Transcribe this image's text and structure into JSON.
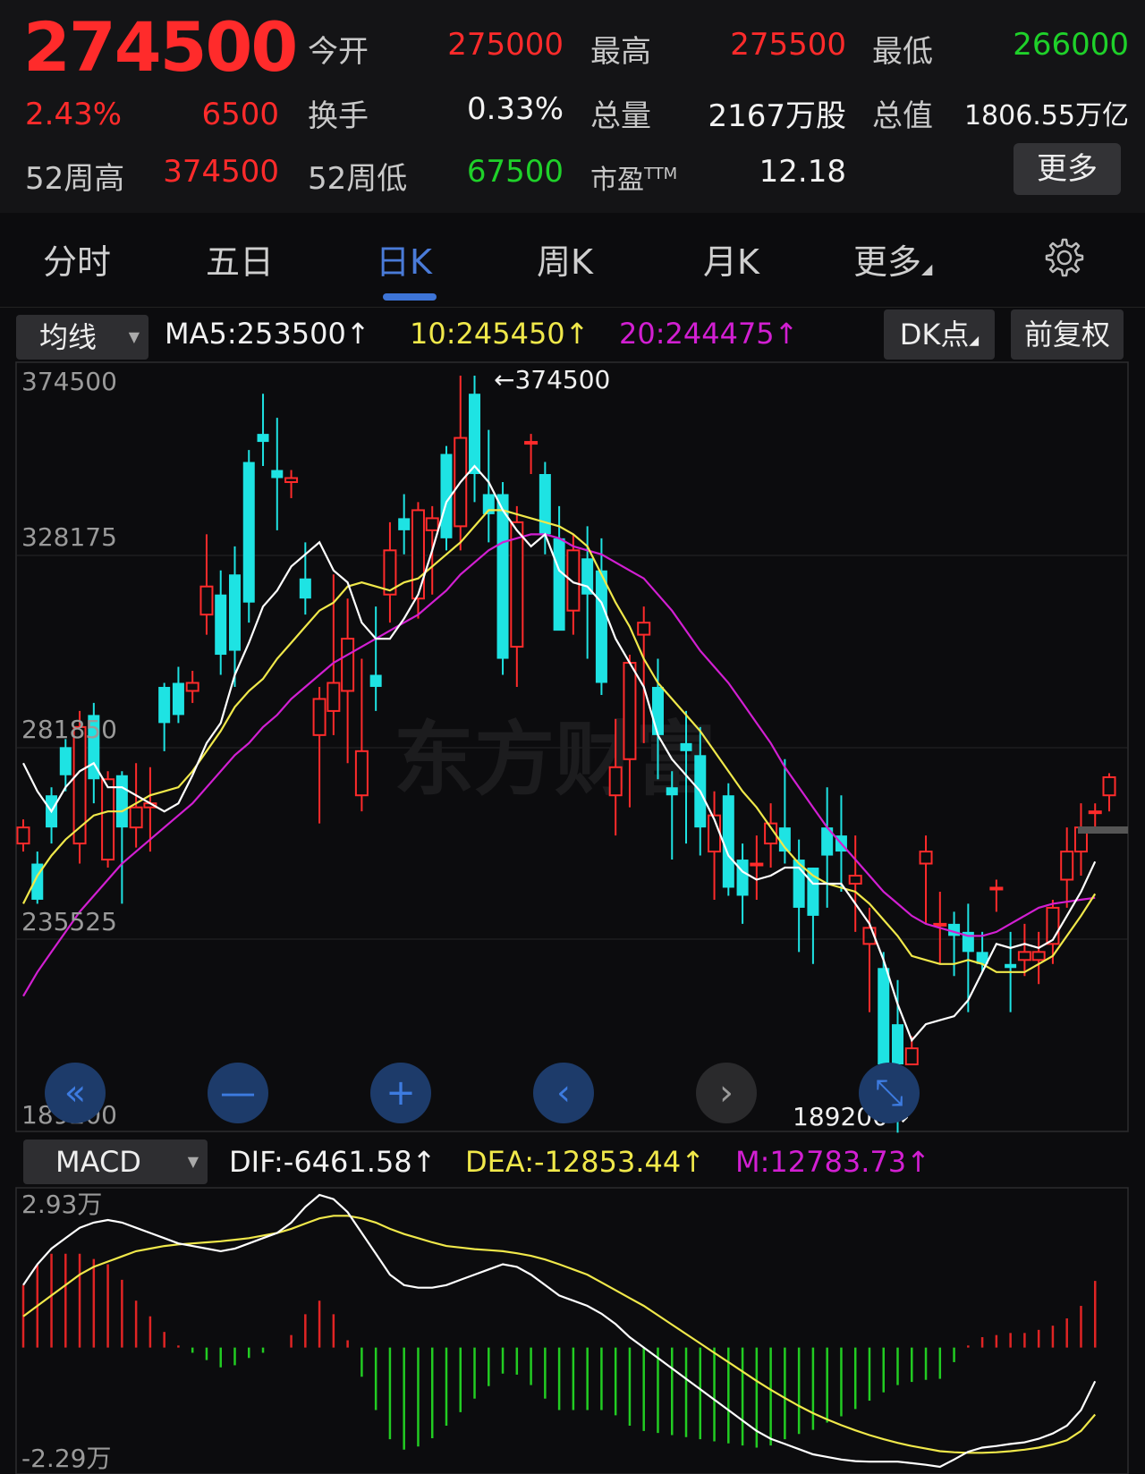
{
  "quote": {
    "price": "274500",
    "change_pct": "2.43%",
    "change_amt": "6500",
    "open_label": "今开",
    "open": "275000",
    "high_label": "最高",
    "high": "275500",
    "low_label": "最低",
    "low": "266000",
    "turnover_label": "换手",
    "turnover": "0.33%",
    "volume_label": "总量",
    "volume": "2167万股",
    "mktcap_label": "总值",
    "mktcap": "1806.55万亿",
    "w52h_label": "52周高",
    "w52h": "374500",
    "w52l_label": "52周低",
    "w52l": "67500",
    "pe_label": "市盈",
    "pe_sup": "TTM",
    "pe": "12.18",
    "more_label": "更多"
  },
  "tabs": [
    {
      "label": "分时",
      "active": false
    },
    {
      "label": "五日",
      "active": false
    },
    {
      "label": "日K",
      "active": true
    },
    {
      "label": "周K",
      "active": false
    },
    {
      "label": "月K",
      "active": false
    },
    {
      "label": "更多",
      "active": false
    }
  ],
  "settings_icon": "gear-icon",
  "ma_bar": {
    "selector": "均线",
    "ma5": "MA5:253500↑",
    "ma10": "10:245450↑",
    "ma20": "20:244475↑",
    "dk_label": "DK点",
    "adjust_label": "前复权"
  },
  "kline": {
    "y_labels": [
      "374500",
      "328175",
      "281850",
      "235525",
      "189200"
    ],
    "max_note": "←374500",
    "min_note": "189200→",
    "watermark": "东方财富"
  },
  "controls": [
    {
      "icon": "double-left-icon",
      "glyph": "«"
    },
    {
      "icon": "zoom-out-icon",
      "glyph": "—"
    },
    {
      "icon": "zoom-in-icon",
      "glyph": "+"
    },
    {
      "icon": "left-icon",
      "glyph": "‹"
    },
    {
      "icon": "right-icon",
      "glyph": "›"
    },
    {
      "icon": "fullscreen-icon",
      "glyph": "⤡"
    }
  ],
  "macd_bar": {
    "selector": "MACD",
    "dif": "DIF:-6461.58↑",
    "dea": "DEA:-12853.44↑",
    "m": "M:12783.73↑",
    "y_top": "2.93万",
    "y_bottom": "-2.29万"
  },
  "colors": {
    "up": "#ff2b2b",
    "down": "#1ee3e3",
    "ma5": "#ffffff",
    "ma10": "#f0e84a",
    "ma20": "#d21fd2",
    "macd_up": "#e02424",
    "macd_down": "#22cc22"
  },
  "chart_data": {
    "type": "candlestick",
    "ylim": [
      189200,
      374500
    ],
    "candles": [
      [
        258000,
        262000,
        264000,
        256000
      ],
      [
        253000,
        244000,
        256000,
        243000
      ],
      [
        270000,
        262000,
        272000,
        258000
      ],
      [
        282000,
        275000,
        284000,
        271000
      ],
      [
        258000,
        287000,
        291000,
        253000
      ],
      [
        290000,
        274000,
        293000,
        268000
      ],
      [
        254000,
        274000,
        276000,
        252000
      ],
      [
        275000,
        262000,
        276000,
        243000
      ],
      [
        262000,
        267000,
        278000,
        257000
      ],
      [
        267000,
        268000,
        277000,
        256000
      ],
      [
        297000,
        288000,
        298000,
        281000
      ],
      [
        298000,
        290000,
        302000,
        288000
      ],
      [
        296000,
        298000,
        301000,
        293000
      ],
      [
        315000,
        322000,
        335000,
        310000
      ],
      [
        320000,
        305000,
        326000,
        300000
      ],
      [
        325000,
        306000,
        332000,
        297000
      ],
      [
        353000,
        318000,
        356000,
        313000
      ],
      [
        360000,
        358000,
        370000,
        352000
      ],
      [
        351000,
        349000,
        364000,
        336000
      ],
      [
        348000,
        349000,
        351000,
        344000
      ],
      [
        324000,
        319000,
        333000,
        315000
      ],
      [
        285000,
        294000,
        297000,
        263000
      ],
      [
        291000,
        298000,
        325000,
        285000
      ],
      [
        296000,
        309000,
        319000,
        278000
      ],
      [
        270000,
        281000,
        304000,
        266000
      ],
      [
        300000,
        297000,
        317000,
        291000
      ],
      [
        320000,
        331000,
        338000,
        313000
      ],
      [
        339000,
        336000,
        345000,
        330000
      ],
      [
        319000,
        341000,
        343000,
        314000
      ],
      [
        336000,
        339000,
        342000,
        320000
      ],
      [
        355000,
        334000,
        357000,
        331000
      ],
      [
        337000,
        359000,
        374500,
        331000
      ],
      [
        370000,
        350000,
        374500,
        343000
      ],
      [
        345000,
        340000,
        361000,
        333000
      ],
      [
        345000,
        304000,
        348000,
        300000
      ],
      [
        307000,
        338000,
        342000,
        297000
      ],
      [
        358000,
        358000,
        360000,
        350000
      ],
      [
        350000,
        335000,
        353000,
        330000
      ],
      [
        334000,
        311000,
        342000,
        314000
      ],
      [
        316000,
        331000,
        335000,
        310000
      ],
      [
        329000,
        320000,
        337000,
        304000
      ],
      [
        326000,
        298000,
        334000,
        295000
      ],
      [
        270000,
        277000,
        289000,
        260000
      ],
      [
        279000,
        303000,
        305000,
        267000
      ],
      [
        310000,
        313000,
        317000,
        283000
      ],
      [
        297000,
        285000,
        304000,
        274000
      ],
      [
        272000,
        270000,
        276000,
        254000
      ],
      [
        283000,
        281000,
        291000,
        258000
      ],
      [
        280000,
        262000,
        287000,
        255000
      ],
      [
        256000,
        265000,
        271000,
        244000
      ],
      [
        270000,
        247000,
        273000,
        245000
      ],
      [
        254000,
        245000,
        258000,
        238000
      ],
      [
        253000,
        253000,
        260000,
        244000
      ],
      [
        258000,
        263000,
        268000,
        252000
      ],
      [
        262000,
        256000,
        279000,
        253000
      ],
      [
        254000,
        242000,
        259000,
        231000
      ],
      [
        252000,
        240000,
        252000,
        228000
      ],
      [
        262000,
        255000,
        272000,
        242000
      ],
      [
        260000,
        256000,
        270000,
        246000
      ],
      [
        248000,
        250000,
        260000,
        236000
      ],
      [
        233000,
        237000,
        242000,
        216000
      ],
      [
        227000,
        203000,
        231000,
        198000
      ],
      [
        213000,
        203000,
        224000,
        186000
      ],
      [
        203000,
        207000,
        210000,
        205000
      ],
      [
        253000,
        256000,
        260000,
        238000
      ],
      [
        238000,
        238000,
        246000,
        228000
      ],
      [
        238000,
        235000,
        241000,
        225000
      ],
      [
        236000,
        231000,
        243000,
        216000
      ],
      [
        231000,
        228000,
        236000,
        226000
      ],
      [
        247000,
        247000,
        249000,
        241000
      ],
      [
        228000,
        227000,
        236000,
        216000
      ],
      [
        229000,
        231000,
        238000,
        225000
      ],
      [
        229000,
        231000,
        236000,
        223000
      ],
      [
        233000,
        242000,
        244000,
        228000
      ],
      [
        249000,
        256000,
        262000,
        242000
      ],
      [
        256000,
        262000,
        268000,
        250000
      ],
      [
        266000,
        266000,
        268000,
        262000
      ],
      [
        270000,
        274500,
        275500,
        266000
      ]
    ],
    "ma5": [
      278000,
      271000,
      266000,
      272000,
      276000,
      278000,
      272000,
      272000,
      270000,
      268000,
      266000,
      268000,
      275000,
      283000,
      288000,
      300000,
      308000,
      317000,
      321000,
      327000,
      330000,
      333000,
      326000,
      323000,
      313000,
      309000,
      309000,
      314000,
      320000,
      331000,
      343000,
      348000,
      352000,
      348000,
      341000,
      336000,
      332000,
      335000,
      326000,
      323000,
      322000,
      318000,
      309000,
      303000,
      297000,
      285000,
      279000,
      275000,
      271000,
      264000,
      255000,
      251000,
      249000,
      250000,
      252000,
      252000,
      248000,
      248000,
      248000,
      243000,
      238000,
      229000,
      218000,
      209000,
      213000,
      214000,
      215000,
      219000,
      226000,
      233000,
      232000,
      233000,
      232000,
      234000,
      240000,
      246000,
      253500
    ],
    "ma10": [
      243000,
      250000,
      255000,
      259000,
      262000,
      265000,
      266000,
      266000,
      268000,
      270000,
      271000,
      272000,
      276000,
      281000,
      286000,
      292000,
      296000,
      299000,
      304000,
      308000,
      312000,
      316000,
      318000,
      322000,
      323000,
      322000,
      321000,
      323000,
      324000,
      327000,
      330000,
      333000,
      337000,
      341000,
      341000,
      340000,
      339000,
      338000,
      337000,
      335000,
      332000,
      325000,
      318000,
      312000,
      304000,
      298000,
      294000,
      290000,
      286000,
      281000,
      276000,
      271000,
      267000,
      262000,
      257000,
      253000,
      250000,
      248000,
      247000,
      246000,
      243000,
      239000,
      235000,
      230000,
      229000,
      228000,
      228000,
      229000,
      228000,
      226000,
      226000,
      226000,
      228000,
      230000,
      235000,
      240000,
      245450
    ],
    "ma20": [
      220000,
      226000,
      231000,
      236000,
      241000,
      245000,
      249000,
      253000,
      256000,
      259000,
      262000,
      265000,
      268000,
      272000,
      276000,
      280000,
      283000,
      287000,
      290000,
      294000,
      297000,
      300000,
      303000,
      305000,
      307000,
      309000,
      311000,
      313000,
      315000,
      318000,
      321000,
      325000,
      328000,
      331000,
      333000,
      334000,
      335000,
      335000,
      334000,
      332000,
      331000,
      330000,
      328000,
      326000,
      324000,
      320000,
      316000,
      311000,
      306000,
      302000,
      298000,
      293000,
      288000,
      283000,
      277000,
      272000,
      267000,
      262000,
      258000,
      254000,
      250000,
      246000,
      243000,
      240000,
      238000,
      237000,
      236000,
      235000,
      235000,
      236000,
      238000,
      240000,
      242000,
      243000,
      243500,
      244000,
      244475
    ],
    "macd_dif": [
      12000,
      16000,
      19000,
      21000,
      23000,
      24000,
      24500,
      24000,
      23000,
      22000,
      21000,
      20000,
      19500,
      19000,
      18500,
      19000,
      20000,
      21000,
      22000,
      24000,
      27000,
      29300,
      28500,
      26000,
      22000,
      18000,
      14000,
      12000,
      11500,
      11500,
      12000,
      13000,
      14000,
      15000,
      16000,
      15500,
      14000,
      12000,
      10000,
      9000,
      8000,
      6500,
      4500,
      2000,
      0,
      -2000,
      -4000,
      -6000,
      -8000,
      -10000,
      -12000,
      -14000,
      -16000,
      -17500,
      -18500,
      -19500,
      -20500,
      -21000,
      -21500,
      -21800,
      -21900,
      -21900,
      -21900,
      -22200,
      -22500,
      -22900,
      -21500,
      -20000,
      -19200,
      -18900,
      -18500,
      -18200,
      -17500,
      -16500,
      -15000,
      -12000,
      -6461.58
    ],
    "macd_dea": [
      6000,
      8000,
      10000,
      12000,
      14000,
      15500,
      16500,
      17500,
      18500,
      19000,
      19500,
      19800,
      20000,
      20200,
      20400,
      20700,
      21000,
      21500,
      22000,
      22800,
      23800,
      24800,
      25300,
      25300,
      24800,
      24000,
      22800,
      21800,
      21000,
      20200,
      19500,
      19200,
      18900,
      18700,
      18500,
      18100,
      17600,
      16900,
      16000,
      15000,
      14000,
      12500,
      11000,
      9500,
      8000,
      6200,
      4400,
      2600,
      800,
      -1000,
      -2800,
      -4600,
      -6400,
      -8100,
      -9700,
      -11200,
      -12600,
      -13800,
      -14900,
      -15900,
      -16800,
      -17600,
      -18300,
      -18900,
      -19400,
      -19900,
      -20100,
      -20200,
      -20200,
      -20100,
      -19900,
      -19600,
      -19200,
      -18600,
      -17800,
      -16000,
      -12853.44
    ]
  }
}
